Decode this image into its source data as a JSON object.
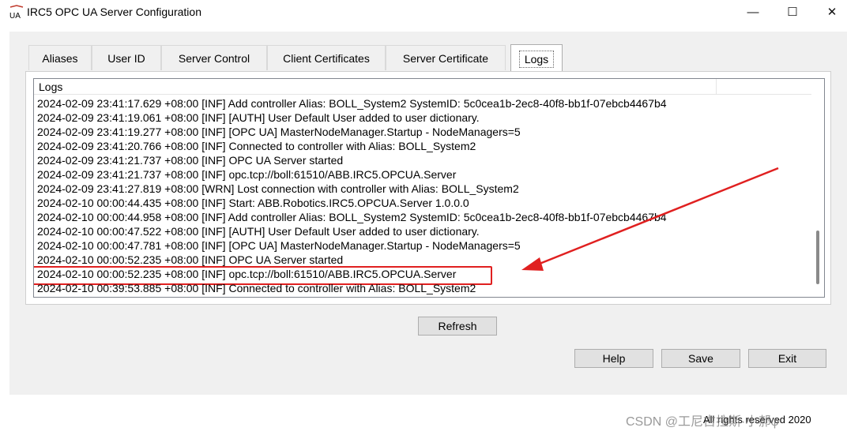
{
  "window": {
    "title": "IRC5 OPC UA Server Configuration",
    "icon_text": "UA",
    "minimize_glyph": "—",
    "maximize_glyph": "☐",
    "close_glyph": "✕"
  },
  "tabs": [
    {
      "label": "Aliases",
      "active": false
    },
    {
      "label": "User ID",
      "active": false
    },
    {
      "label": "Server Control",
      "active": false
    },
    {
      "label": "Client Certificates",
      "active": false
    },
    {
      "label": "Server Certificate",
      "active": false
    },
    {
      "label": "Logs",
      "active": true
    }
  ],
  "logs": {
    "column_header": "Logs",
    "highlighted_index": 12,
    "entries": [
      "2024-02-09 23:41:17.629 +08:00 [INF] Add controller Alias: BOLL_System2  SystemID: 5c0cea1b-2ec8-40f8-bb1f-07ebcb4467b4",
      "2024-02-09 23:41:19.061 +08:00 [INF] [AUTH] User Default User added to user dictionary.",
      "2024-02-09 23:41:19.277 +08:00 [INF] [OPC UA] MasterNodeManager.Startup - NodeManagers=5",
      "2024-02-09 23:41:20.766 +08:00 [INF] Connected to controller with Alias: BOLL_System2",
      "2024-02-09 23:41:21.737 +08:00 [INF] OPC UA Server started",
      "2024-02-09 23:41:21.737 +08:00 [INF] opc.tcp://boll:61510/ABB.IRC5.OPCUA.Server",
      "2024-02-09 23:41:27.819 +08:00 [WRN] Lost connection with controller with Alias: BOLL_System2",
      "2024-02-10 00:00:44.435 +08:00 [INF] Start: ABB.Robotics.IRC5.OPCUA.Server 1.0.0.0",
      "2024-02-10 00:00:44.958 +08:00 [INF] Add controller Alias: BOLL_System2  SystemID: 5c0cea1b-2ec8-40f8-bb1f-07ebcb4467b4",
      "2024-02-10 00:00:47.522 +08:00 [INF] [AUTH] User Default User added to user dictionary.",
      "2024-02-10 00:00:47.781 +08:00 [INF] [OPC UA] MasterNodeManager.Startup - NodeManagers=5",
      "2024-02-10 00:00:52.235 +08:00 [INF] OPC UA Server started",
      "2024-02-10 00:00:52.235 +08:00 [INF] opc.tcp://boll:61510/ABB.IRC5.OPCUA.Server",
      "2024-02-10 00:39:53.885 +08:00 [INF] Connected to controller with Alias: BOLL_System2"
    ]
  },
  "buttons": {
    "refresh": "Refresh",
    "help": "Help",
    "save": "Save",
    "exit": "Exit"
  },
  "footer": {
    "copyright": "All rights reserved 2020"
  },
  "watermark": {
    "text": "CSDN @工尼古拉斯·小郝φ"
  },
  "annotation": {
    "color": "#e02020"
  }
}
